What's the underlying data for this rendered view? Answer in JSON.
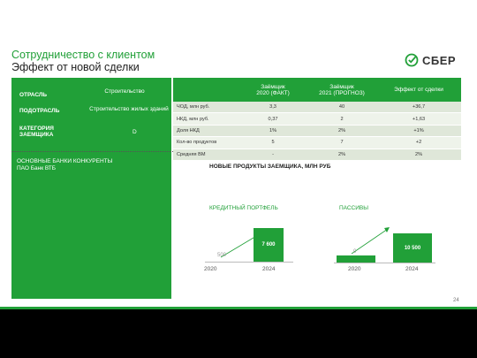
{
  "header": {
    "title": "Сотрудничество с клиентом",
    "subtitle": "Эффект от новой сделки"
  },
  "logo": {
    "text": "СБЕР"
  },
  "client": {
    "industry_label": "ОТРАСЛЬ",
    "industry_value": "Строительство",
    "subindustry_label": "ПОДОТРАСЛЬ",
    "subindustry_value": "Строительство жилых зданий",
    "category_label": "КАТЕГОРИЯ ЗАЕМЩИКА",
    "category_value": "D",
    "competitors_label": "ОСНОВНЫЕ БАНКИ КОНКУРЕНТЫ",
    "competitors_value": "ПАО Банк ВТБ"
  },
  "table": {
    "headers": [
      "",
      "Заёмщик\n2020 (ФАКТ)",
      "Заёмщик\n2021 (ПРОГНОЗ)",
      "Эффект от сделки"
    ],
    "rows": [
      [
        "ЧОД, млн руб.",
        "3,3",
        "40",
        "+36,7"
      ],
      [
        "НКД, млн руб.",
        "0,37",
        "2",
        "+1,63"
      ],
      [
        "Доля НКД",
        "1%",
        "2%",
        "+1%"
      ],
      [
        "Кол-во продуктов",
        "5",
        "7",
        "+2"
      ],
      [
        "Средняя ВМ",
        "-",
        "2%",
        "2%"
      ]
    ]
  },
  "new_products": {
    "title": "НОВЫЕ ПРОДУКТЫ ЗАЕМЩИКА, МЛН РУБ",
    "credit": {
      "label": "КРЕДИТНЫЙ ПОРТФЕЛЬ",
      "years": [
        "2020",
        "2024"
      ],
      "values": [
        "500",
        "7 600"
      ]
    },
    "liabilities": {
      "label": "ПАССИВЫ",
      "years": [
        "2020",
        "2024"
      ],
      "values": [
        "0",
        "10 500"
      ]
    }
  },
  "page_number": "24",
  "colors": {
    "brand": "#21a038"
  }
}
